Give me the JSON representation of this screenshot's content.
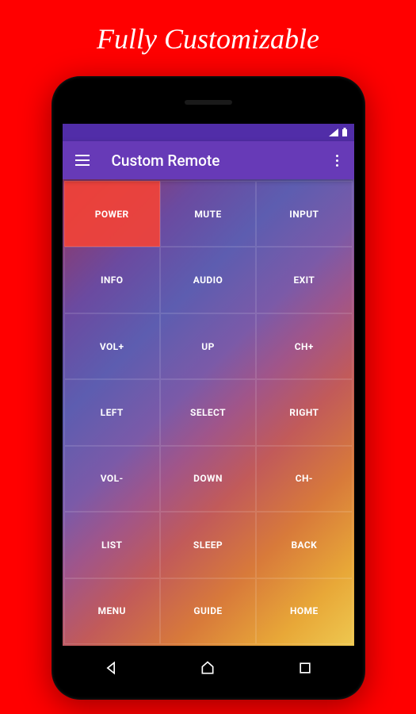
{
  "headline": "Fully Customizable",
  "appbar": {
    "title": "Custom Remote"
  },
  "buttons": [
    {
      "label": "POWER",
      "key": "power"
    },
    {
      "label": "MUTE",
      "key": "mute"
    },
    {
      "label": "INPUT",
      "key": "input"
    },
    {
      "label": "INFO",
      "key": "info"
    },
    {
      "label": "AUDIO",
      "key": "audio"
    },
    {
      "label": "EXIT",
      "key": "exit"
    },
    {
      "label": "VOL+",
      "key": "vol-up"
    },
    {
      "label": "UP",
      "key": "up"
    },
    {
      "label": "CH+",
      "key": "ch-up"
    },
    {
      "label": "LEFT",
      "key": "left"
    },
    {
      "label": "SELECT",
      "key": "select"
    },
    {
      "label": "RIGHT",
      "key": "right"
    },
    {
      "label": "VOL-",
      "key": "vol-down"
    },
    {
      "label": "DOWN",
      "key": "down"
    },
    {
      "label": "CH-",
      "key": "ch-down"
    },
    {
      "label": "LIST",
      "key": "list"
    },
    {
      "label": "SLEEP",
      "key": "sleep"
    },
    {
      "label": "BACK",
      "key": "back"
    },
    {
      "label": "MENU",
      "key": "menu"
    },
    {
      "label": "GUIDE",
      "key": "guide"
    },
    {
      "label": "HOME",
      "key": "home"
    }
  ]
}
